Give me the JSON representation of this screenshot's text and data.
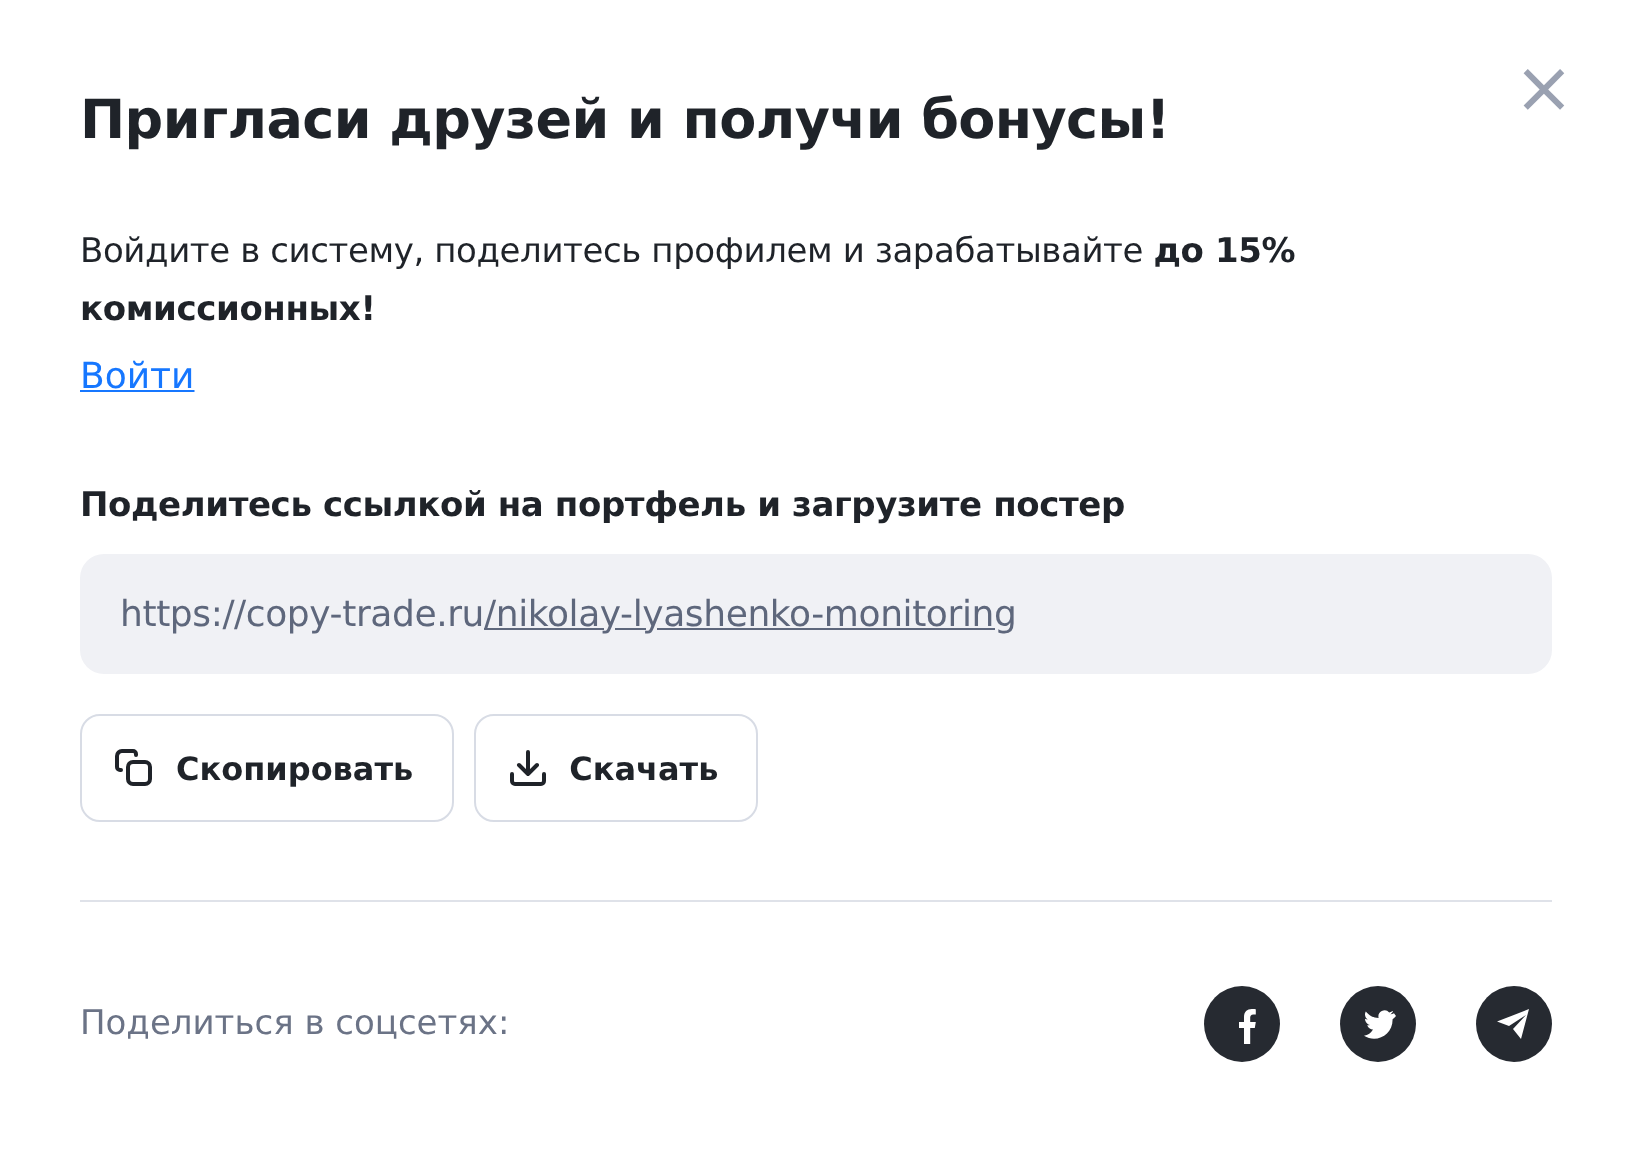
{
  "dialog": {
    "title": "Пригласи друзей и получи бонусы!",
    "close": "×",
    "description": "Войдите в систему, поделитесь профилем и зарабатывайте **до 15% комиссионных!**",
    "login_link": "Войти"
  },
  "share_link": {
    "label": "Поделитесь ссылкой на портфель и загрузите постер",
    "url_base": "https://copy-trade.ru",
    "url_path": "/nikolay-lyashenko-monitoring",
    "buttons": [
      {
        "kind": "copy",
        "label": "Скопировать"
      },
      {
        "kind": "download",
        "label": "Скачать"
      }
    ]
  },
  "social": {
    "label": "Поделиться в соцсетях:",
    "networks": [
      {
        "kind": "facebook"
      },
      {
        "kind": "twitter"
      },
      {
        "kind": "telegram"
      }
    ]
  }
}
